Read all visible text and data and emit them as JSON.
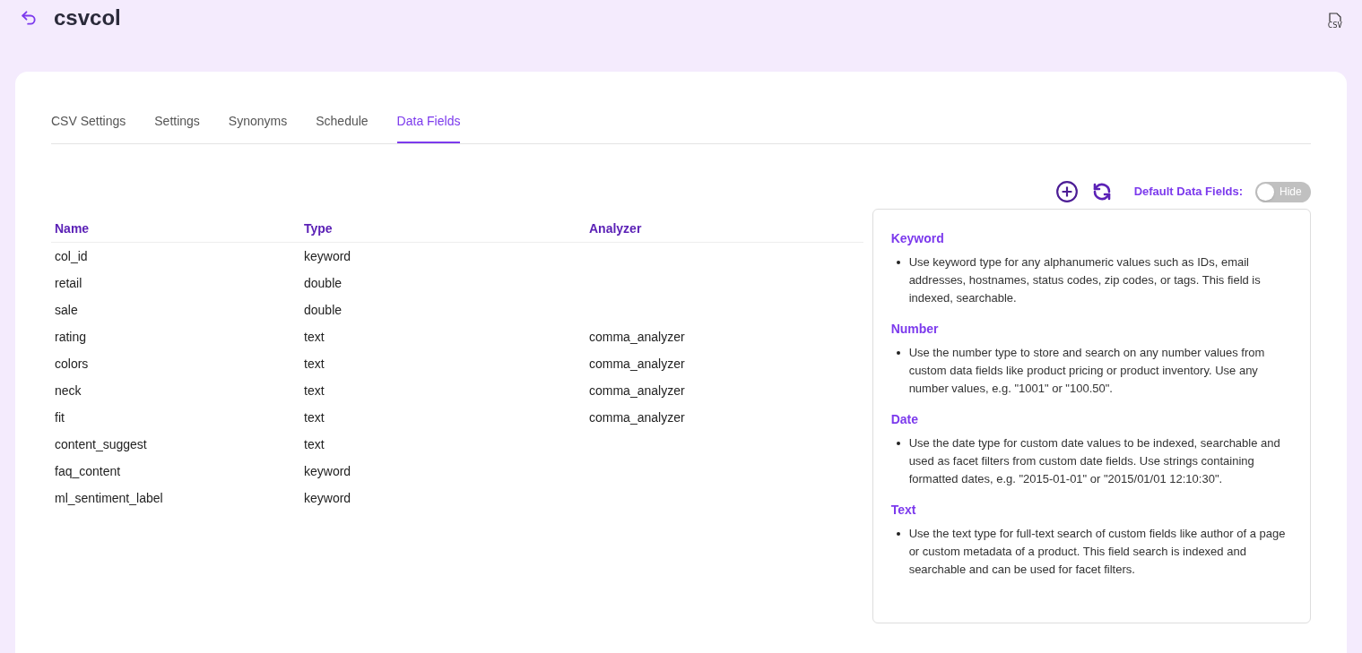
{
  "header": {
    "title": "csvcol",
    "export_label": "CSV"
  },
  "tabs": [
    {
      "label": "CSV Settings",
      "selected": false
    },
    {
      "label": "Settings",
      "selected": false
    },
    {
      "label": "Synonyms",
      "selected": false
    },
    {
      "label": "Schedule",
      "selected": false
    },
    {
      "label": "Data Fields",
      "selected": true
    }
  ],
  "toolbar": {
    "default_fields_label": "Default Data Fields:",
    "toggle": {
      "on": false,
      "label": "Hide"
    }
  },
  "table": {
    "columns": [
      "Name",
      "Type",
      "Analyzer"
    ],
    "rows": [
      [
        "col_id",
        "keyword",
        ""
      ],
      [
        "retail",
        "double",
        ""
      ],
      [
        "sale",
        "double",
        ""
      ],
      [
        "rating",
        "text",
        "comma_analyzer"
      ],
      [
        "colors",
        "text",
        "comma_analyzer"
      ],
      [
        "neck",
        "text",
        "comma_analyzer"
      ],
      [
        "fit",
        "text",
        "comma_analyzer"
      ],
      [
        "content_suggest",
        "text",
        ""
      ],
      [
        "faq_content",
        "keyword",
        ""
      ],
      [
        "ml_sentiment_label",
        "keyword",
        ""
      ]
    ]
  },
  "help": [
    {
      "title": "Keyword",
      "text": "Use keyword type for any alphanumeric values such as IDs, email addresses, hostnames, status codes, zip codes, or tags. This field is indexed, searchable."
    },
    {
      "title": "Number",
      "text": "Use the number type to store and search on any number values from custom data fields like product pricing or product inventory. Use any number values, e.g. \"1001\" or \"100.50\"."
    },
    {
      "title": "Date",
      "text": "Use the date type for custom date values to be indexed, searchable and used as facet filters from custom date fields. Use strings containing formatted dates, e.g. \"2015-01-01\" or \"2015/01/01 12:10:30\"."
    },
    {
      "title": "Text",
      "text": "Use the text type for full-text search of custom fields like author of a page or custom metadata of a product. This field search is indexed and searchable and can be used for facet filters."
    }
  ]
}
